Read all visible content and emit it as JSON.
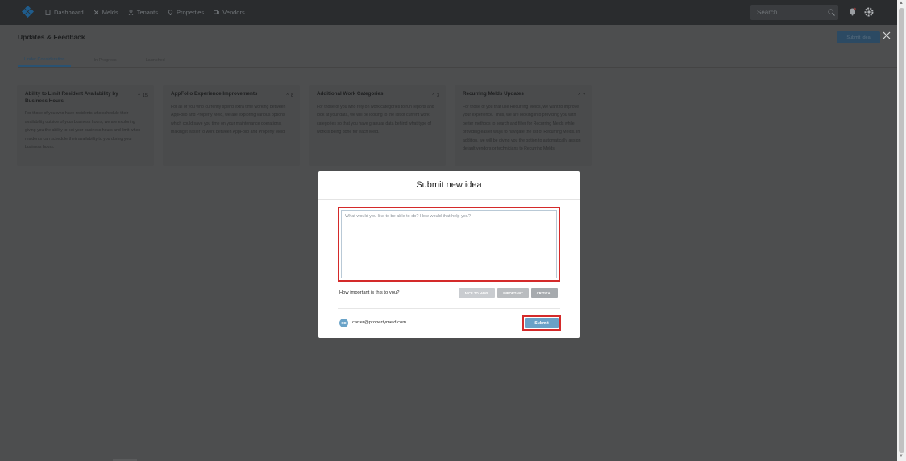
{
  "nav": {
    "items": [
      {
        "label": "Dashboard",
        "icon": "document-icon"
      },
      {
        "label": "Melds",
        "icon": "tools-icon"
      },
      {
        "label": "Tenants",
        "icon": "person-icon"
      },
      {
        "label": "Properties",
        "icon": "pin-icon"
      },
      {
        "label": "Vendors",
        "icon": "truck-icon"
      }
    ],
    "search_placeholder": "Search"
  },
  "page": {
    "title": "Updates & Feedback",
    "submit_idea_label": "Submit Idea",
    "tabs": [
      {
        "label": "Under Consideration",
        "active": true
      },
      {
        "label": "In Progress",
        "active": false
      },
      {
        "label": "Launched",
        "active": false
      }
    ],
    "cards": [
      {
        "title": "Ability to Limit Resident Availability by Business Hours",
        "votes": "15",
        "text": "For those of you who have residents who schedule their availability outside of your business hours, we are exploring giving you the ability to set your business hours and limit when residents can schedule their availability to you during your business hours."
      },
      {
        "title": "AppFolio Experience Improvements",
        "votes": "8",
        "text": "For all of you who currently spend extra time working between AppFolio and Property Meld, we are exploring various options which could save you time on your maintenance operations, making it easier to work between AppFolio and Property Meld."
      },
      {
        "title": "Additional Work Categories",
        "votes": "3",
        "text": "For those of you who rely on work categories to run reports and look at your data, we will be looking to the list of current work categories so that you have granular data behind what type of work is being done for each Meld."
      },
      {
        "title": "Recurring Melds Updates",
        "votes": "7",
        "text": "For those of you that use Recurring Melds, we want to improve your experience. Thus, we are looking into providing you with better methods to search and filter for Recurring Melds while providing easier ways to navigate the list of Recurring Melds. In addition, we will be giving you the option to automatically assign default vendors or technicians to Recurring Melds."
      }
    ]
  },
  "modal": {
    "title": "Submit new idea",
    "textarea_placeholder": "What would you like to be able to do? How would that help you?",
    "importance_label": "How important is this to you?",
    "importance_options": [
      "NICE TO HAVE",
      "IMPORTANT",
      "CRITICAL"
    ],
    "user_initials": "CD",
    "user_email": "carter@propertymeld.com",
    "submit_label": "Submit"
  },
  "colors": {
    "accent": "#6aa1c7",
    "highlight": "#d42a2a"
  }
}
